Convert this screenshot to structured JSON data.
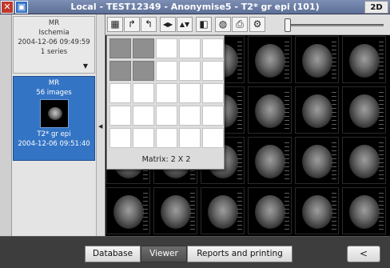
{
  "titlebar": {
    "close_glyph": "✕",
    "window_glyph": "▣",
    "title": "Local - TEST12349 - Anonymise5 - T2* gr epi (101)",
    "mode_label": "2D"
  },
  "sidebar": {
    "series": [
      {
        "modality": "MR",
        "description": "Ischemia",
        "datetime": "2004-12-06 09:49:59",
        "count": "1 series"
      },
      {
        "modality": "MR",
        "count": "56 images",
        "description": "T2* gr epi",
        "datetime": "2004-12-06 09:51:40"
      }
    ],
    "expand_glyph": "▼",
    "collapse_glyph": "◀"
  },
  "toolbar": {
    "icons": [
      "layout-grid-icon",
      "rotate-right-icon",
      "rotate-left-icon",
      "flip-horizontal-icon",
      "flip-vertical-icon",
      "invert-icon",
      "cine-icon",
      "print-icon",
      "settings-icon"
    ],
    "glyphs": [
      "▦",
      "↱",
      "↰",
      "◀▶",
      "▲▼",
      "◧",
      "◍",
      "⎙",
      "⚙"
    ]
  },
  "matrix_popup": {
    "label": "Matrix: 2 X 2",
    "rows": 5,
    "cols": 5,
    "selected_rows": 2,
    "selected_cols": 2
  },
  "bottombar": {
    "tabs": [
      "Database",
      "Viewer",
      "Reports and printing"
    ],
    "active_tab": "Viewer",
    "back_label": "<"
  }
}
